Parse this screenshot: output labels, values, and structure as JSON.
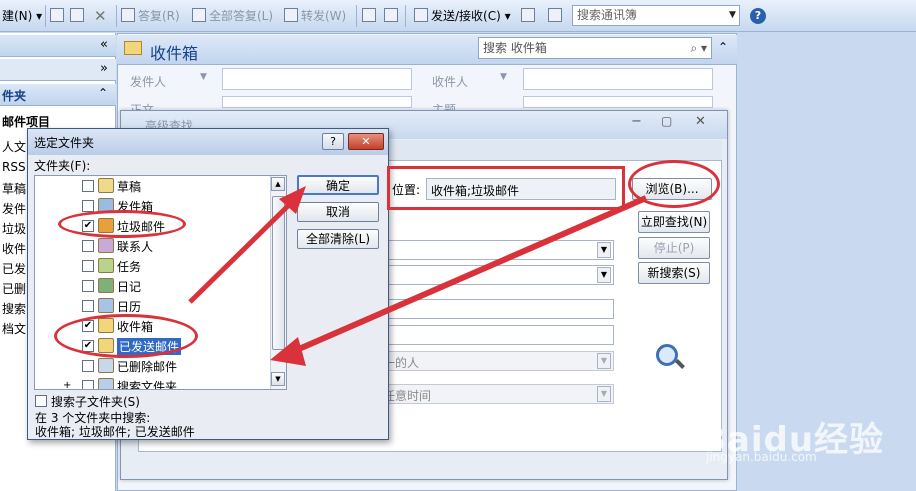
{
  "toolbar": {
    "new_label": "建(N)",
    "reply": "答复(R)",
    "reply_all": "全部答复(L)",
    "forward": "转发(W)",
    "send_receive": "发送/接收(C)",
    "address_book_search": "搜索通讯簿"
  },
  "nav": {
    "collapse_glyph": "«",
    "expand_glyph": "»",
    "folders_header": "件夹",
    "mail_items": "邮件项目",
    "items": [
      "人文",
      "RSS",
      "草稿",
      "发件",
      "垃圾",
      "收件",
      "已发",
      "已删",
      "搜索",
      "档文"
    ]
  },
  "inbox": {
    "title": "收件箱",
    "search_placeholder": "搜索 收件箱",
    "fields": [
      "发件人",
      "收件人",
      "正文",
      "主题"
    ]
  },
  "advanced_find": {
    "title": "高级查找",
    "location_label": "位置:",
    "location_value": "收件箱;垃圾邮件",
    "browse_button": "浏览(B)...",
    "find_now_button": "立即查找(N)",
    "stop_button": "停止(P)",
    "new_search_button": "新搜索(S)",
    "field_person": "一的人",
    "field_time": "任意时间"
  },
  "dialog": {
    "title": "选定文件夹",
    "folders_label": "文件夹(F):",
    "help_glyph": "?",
    "close_glyph": "✕",
    "ok_button": "确定",
    "cancel_button": "取消",
    "clear_all_button": "全部清除(L)",
    "subfolders_label": "搜索子文件夹(S)",
    "search_info_line1": "在 3 个文件夹中搜索:",
    "search_info_line2": "收件箱; 垃圾邮件; 已发送邮件",
    "folders": [
      {
        "name": "草稿",
        "checked": false
      },
      {
        "name": "发件箱",
        "checked": false
      },
      {
        "name": "垃圾邮件",
        "checked": true
      },
      {
        "name": "联系人",
        "checked": false
      },
      {
        "name": "任务",
        "checked": false
      },
      {
        "name": "日记",
        "checked": false
      },
      {
        "name": "日历",
        "checked": false
      },
      {
        "name": "收件箱",
        "checked": true
      },
      {
        "name": "已发送邮件",
        "checked": true
      },
      {
        "name": "已删除邮件",
        "checked": false
      },
      {
        "name": "搜索文件夹",
        "checked": false
      }
    ]
  },
  "colors": {
    "annotation_red": "#d9323a",
    "selection_blue": "#3169c6"
  },
  "watermark": {
    "text": "Baidu经验",
    "sub": "jingyan.baidu.com"
  }
}
